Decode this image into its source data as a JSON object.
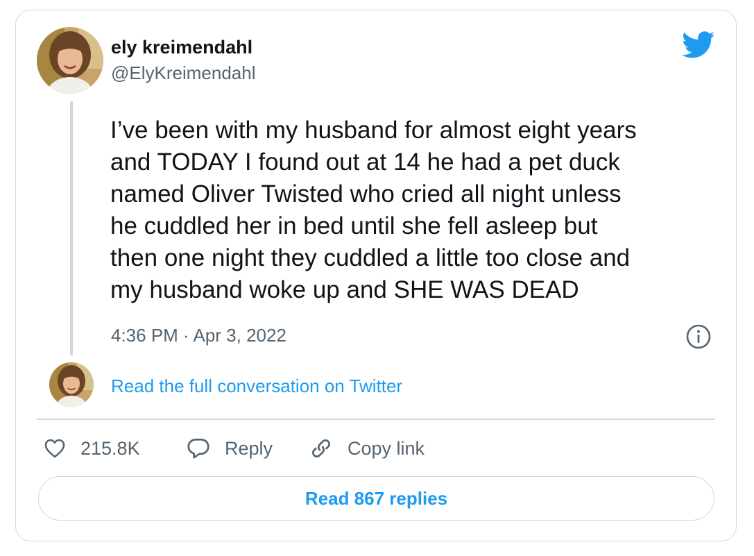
{
  "author": {
    "display_name": "ely kreimendahl",
    "handle": "@ElyKreimendahl"
  },
  "tweet": {
    "lines": [
      "I’ve been with my husband for almost eight years",
      "and TODAY I found out at 14 he had a pet duck",
      "named Oliver Twisted who cried all night unless",
      "he cuddled her in bed until she fell asleep but",
      "then one night they cuddled a little too close and",
      "my husband woke up and SHE WAS DEAD"
    ],
    "timestamp": "4:36 PM · Apr 3, 2022"
  },
  "conversation": {
    "link_text": "Read the full conversation on Twitter"
  },
  "actions": {
    "like_count": "215.8K",
    "reply_label": "Reply",
    "copy_link_label": "Copy link"
  },
  "replies_button": {
    "label": "Read 867 replies"
  },
  "icons": {
    "brand": "twitter-bird-icon",
    "info": "info-icon",
    "like": "heart-icon",
    "reply": "speech-bubble-icon",
    "copy_link": "link-icon"
  },
  "colors": {
    "accent": "#1d9bf0",
    "text_primary": "#0f1419",
    "text_secondary": "#536471",
    "border": "#cfd9de"
  }
}
